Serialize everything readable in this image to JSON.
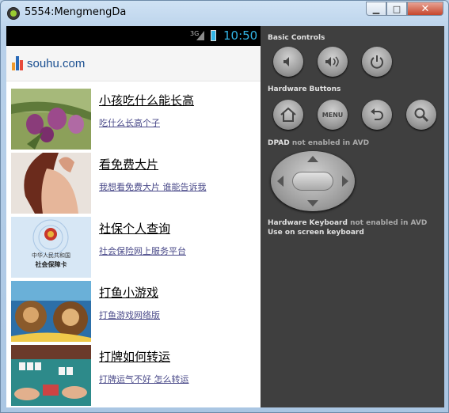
{
  "window": {
    "title": "5554:MengmengDa"
  },
  "statusbar": {
    "network": "3G",
    "time": "10:50"
  },
  "header": {
    "brand": "souhu.com"
  },
  "feed": [
    {
      "title": "小孩吃什么能长高",
      "subtitle": "吃什么长高个子",
      "thumb": "plums-image"
    },
    {
      "title": "看免费大片",
      "subtitle": "我想看免费大片 谁能告诉我",
      "thumb": "woman-back-image"
    },
    {
      "title": "社保个人查询",
      "subtitle": "社会保险网上服务平台",
      "thumb": "social-security-card-image",
      "card_text": [
        "中华人民共和国",
        "社会保障卡"
      ]
    },
    {
      "title": "打鱼小游戏",
      "subtitle": "打鱼游戏网络版",
      "thumb": "cartoon-bears-image"
    },
    {
      "title": "打牌如何转运",
      "subtitle": "打牌运气不好 怎么转运",
      "thumb": "mahjong-image"
    }
  ],
  "panel": {
    "basic_controls": "Basic Controls",
    "hardware_buttons": "Hardware Buttons",
    "dpad_label": "DPAD",
    "dpad_note": "not enabled in AVD",
    "keyboard_label": "Hardware Keyboard",
    "keyboard_note": "not enabled in AVD",
    "keyboard_line2": "Use on screen keyboard",
    "menu_label": "MENU"
  },
  "colors": {
    "accent": "#33b5e5",
    "brand": "#1a4f91",
    "panel": "#3f3f3f"
  }
}
